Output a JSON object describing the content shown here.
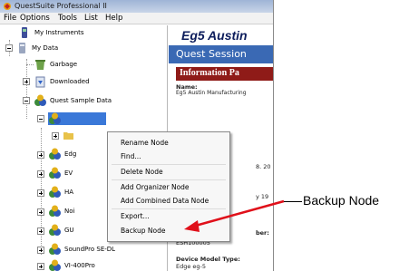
{
  "window": {
    "title": "QuestSuite Professional II"
  },
  "menu": [
    "File",
    "Options",
    "Tools",
    "List",
    "Help"
  ],
  "tree": {
    "items": [
      {
        "label": "My Instruments"
      },
      {
        "label": "My Data"
      },
      {
        "label": "Garbage"
      },
      {
        "label": "Downloaded"
      },
      {
        "label": "Quest Sample Data"
      },
      {
        "label": "Edg"
      },
      {
        "label": "EV"
      },
      {
        "label": "HA"
      },
      {
        "label": "Noi"
      },
      {
        "label": "GU"
      },
      {
        "label": "SoundPro SE-DL"
      },
      {
        "label": "VI-400Pro"
      }
    ]
  },
  "right_panel": {
    "title": "Eg5 Austin",
    "session_title": "Quest Session",
    "info_title": "Information Pa",
    "name_label": "Name:",
    "name_value": "Eg5 Austin Manufacturing",
    "partial_1": "8. 20",
    "partial_2": "y 19",
    "partial_3": "ber:",
    "serial_value": "ESH100005",
    "model_label": "Device Model Type:",
    "model_value": "Edge eg-5"
  },
  "context_menu": {
    "items": [
      "Rename Node",
      "Find...",
      "Delete Node",
      "Add Organizer Node",
      "Add Combined Data Node",
      "Export...",
      "Backup Node"
    ]
  },
  "callout": {
    "text": "Backup Node"
  },
  "colors": {
    "session_bar": "#3a69b4",
    "info_bar": "#8f1b18",
    "arrow": "#e0101a"
  }
}
